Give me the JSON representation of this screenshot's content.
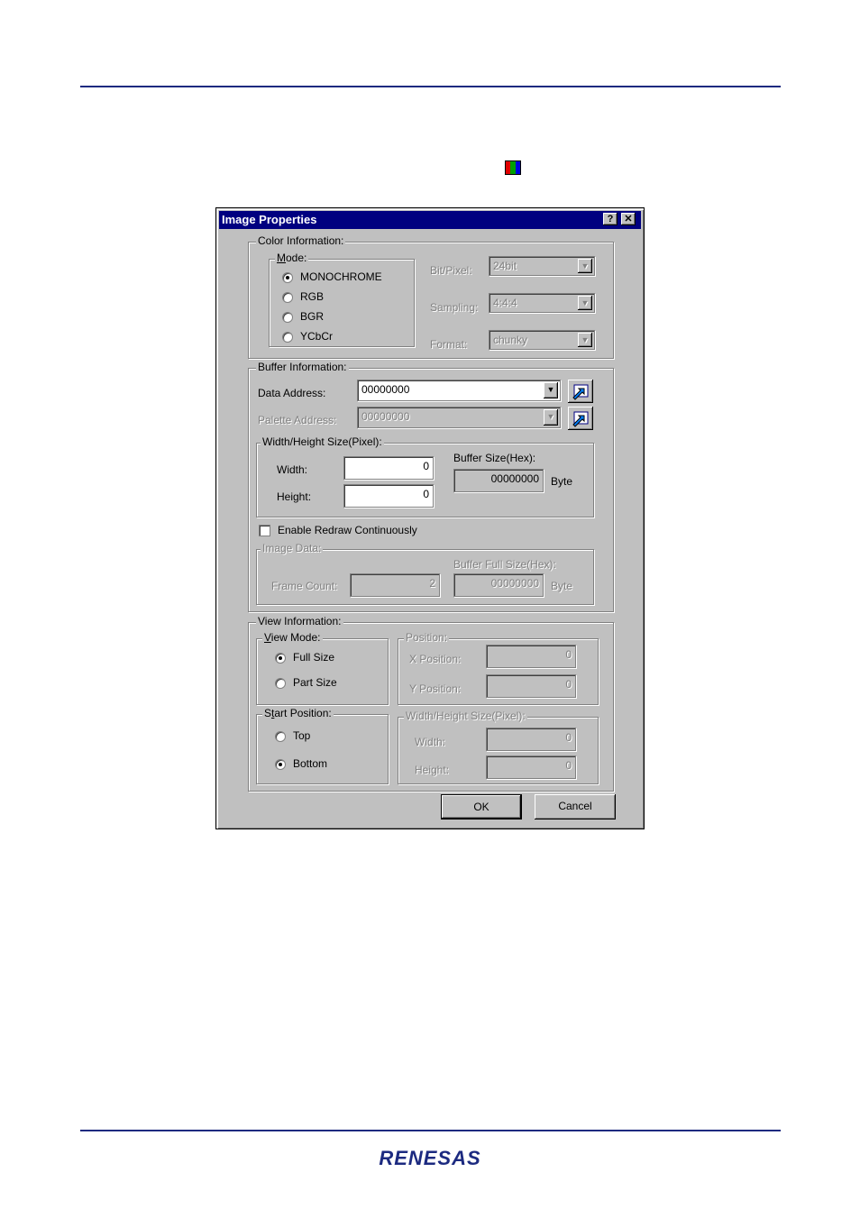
{
  "dialog": {
    "title": "Image Properties",
    "help_label": "?",
    "close_label": "✕",
    "ok_label": "OK",
    "cancel_label": "Cancel"
  },
  "color_info": {
    "group_label": "Color Information:",
    "mode_label": "Mode:",
    "modes": [
      "MONOCHROME",
      "RGB",
      "BGR",
      "YCbCr"
    ],
    "selected_mode": "MONOCHROME",
    "bit_pixel_label": "Bit/Pixel:",
    "bit_pixel_value": "24bit",
    "sampling_label": "Sampling:",
    "sampling_value": "4:4:4",
    "format_label": "Format:",
    "format_value": "chunky"
  },
  "buffer_info": {
    "group_label": "Buffer Information:",
    "data_address_label": "Data Address:",
    "data_address_value": "00000000",
    "palette_address_label": "Palette Address:",
    "palette_address_value": "00000000",
    "size_group_label": "Width/Height Size(Pixel):",
    "width_label": "Width:",
    "width_value": "0",
    "height_label": "Height:",
    "height_value": "0",
    "buffer_size_label": "Buffer Size(Hex):",
    "buffer_size_value": "00000000",
    "byte_label": "Byte",
    "redraw_label": "Enable Redraw Continuously",
    "image_data_label": "Image Data:",
    "frame_count_label": "Frame Count:",
    "frame_count_value": "2",
    "buffer_full_size_label": "Buffer Full Size(Hex):",
    "buffer_full_size_value": "00000000",
    "byte_label2": "Byte"
  },
  "view_info": {
    "group_label": "View Information:",
    "view_mode_label": "View Mode:",
    "full_size_label": "Full Size",
    "part_size_label": "Part Size",
    "position_label": "Position:",
    "x_position_label": "X Position:",
    "x_position_value": "0",
    "y_position_label": "Y Position:",
    "y_position_value": "0",
    "start_position_label": "Start Position:",
    "top_label": "Top",
    "bottom_label": "Bottom",
    "size_group_label": "Width/Height Size(Pixel):",
    "width_label": "Width:",
    "width_value": "0",
    "height_label": "Height:",
    "height_value": "0"
  },
  "footer": {
    "logo_text": "RENESAS"
  },
  "colors": {
    "accent": "#1c2a80",
    "titlebar": "#000080",
    "dialog_bg": "#c0c0c0"
  }
}
